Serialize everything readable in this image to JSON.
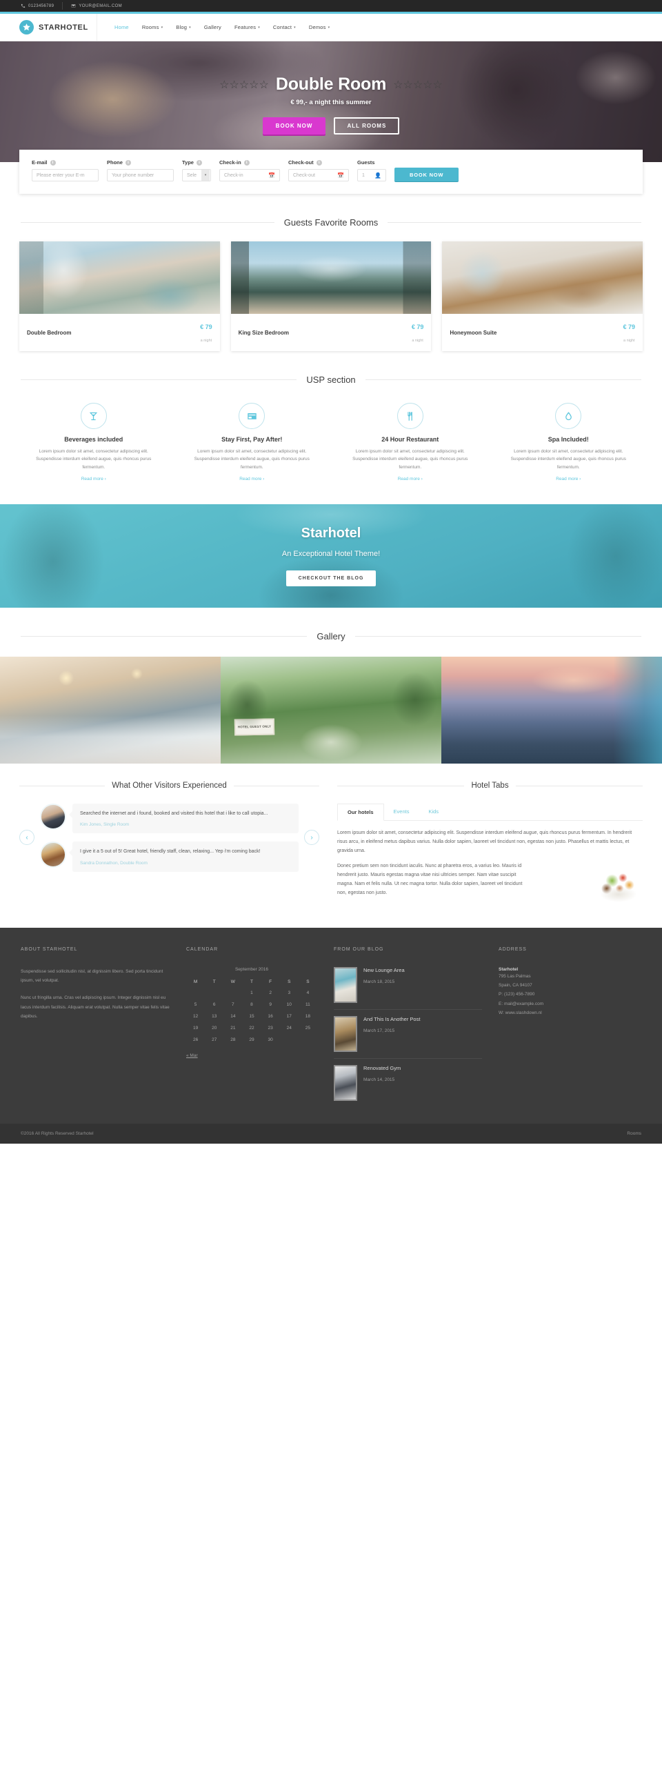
{
  "topbar": {
    "phone": "0123456789",
    "email": "YOUR@EMAIL.COM",
    "phone_icon": "phone-icon",
    "email_icon": "envelope-icon"
  },
  "brand": {
    "name": "STARHOTEL",
    "logo_icon": "star-logo-icon"
  },
  "nav": [
    {
      "label": "Home",
      "active": true,
      "caret": ""
    },
    {
      "label": "Rooms",
      "active": false,
      "caret": "⌄"
    },
    {
      "label": "Blog",
      "active": false,
      "caret": "⌄"
    },
    {
      "label": "Gallery",
      "active": false,
      "caret": ""
    },
    {
      "label": "Features",
      "active": false,
      "caret": "⌄"
    },
    {
      "label": "Contact",
      "active": false,
      "caret": "⌄"
    },
    {
      "label": "Demos",
      "active": false,
      "caret": "⌄"
    }
  ],
  "hero": {
    "stars_left": "☆☆☆☆☆",
    "title": "Double Room",
    "stars_right": "☆☆☆☆☆",
    "subtitle": "€ 99,- a night this summer",
    "book_label": "BOOK NOW",
    "rooms_label": "ALL ROOMS",
    "accent_pink": "#d938cf"
  },
  "booking": {
    "email": {
      "label": "E-mail",
      "placeholder": "Please enter your E-m"
    },
    "phone": {
      "label": "Phone",
      "placeholder": "Your phone number"
    },
    "type": {
      "label": "Type",
      "value": "Sele"
    },
    "checkin": {
      "label": "Check-in",
      "placeholder": "Check-in"
    },
    "checkout": {
      "label": "Check-out",
      "placeholder": "Check-out"
    },
    "guests": {
      "label": "Guests",
      "value": "1"
    },
    "submit_label": "BOOK NOW",
    "accent": "#4cb8cf"
  },
  "rooms_section": {
    "title": "Guests Favorite Rooms",
    "per_night": "a night",
    "items": [
      {
        "name": "Double Bedroom",
        "price": "€ 79"
      },
      {
        "name": "King Size Bedroom",
        "price": "€ 79"
      },
      {
        "name": "Honeymoon Suite",
        "price": "€ 79"
      }
    ]
  },
  "usp_section": {
    "title": "USP section",
    "body": "Lorem ipsum dolor sit amet, consectetur adipiscing elit. Suspendisse interdum eleifend augue, quis rhoncus purus fermentum.",
    "read_more": "Read more ›",
    "items": [
      {
        "title": "Beverages included",
        "icon": "cocktail-glass-icon"
      },
      {
        "title": "Stay First, Pay After!",
        "icon": "credit-card-icon"
      },
      {
        "title": "24 Hour Restaurant",
        "icon": "cutlery-icon"
      },
      {
        "title": "Spa Included!",
        "icon": "spa-drop-icon"
      }
    ]
  },
  "cta": {
    "title": "Starhotel",
    "subtitle": "An Exceptional Hotel Theme!",
    "button_label": "CHECKOUT THE BLOG"
  },
  "gallery": {
    "title": "Gallery",
    "sign_text": "HOTEL GUEST ONLY",
    "items": [
      {
        "alt": "restaurant-kitchen-photo"
      },
      {
        "alt": "garden-path-photo"
      },
      {
        "alt": "poolside-sunset-photo"
      }
    ]
  },
  "testimonials": {
    "title": "What Other Visitors Experienced",
    "prev_icon": "chevron-left-icon",
    "next_icon": "chevron-right-icon",
    "items": [
      {
        "quote": "Searched the internet and i found, booked and visited this hotel that i like to call utopia...",
        "who": "Kim Jones, Single Room",
        "avatar": "male-avatar"
      },
      {
        "quote": "I give it a 5 out of 5! Great hotel, friendly staff, clean, relaxing... Yep i'm coming back!",
        "who": "Sandra Donnathon, Double Room",
        "avatar": "female-avatar"
      }
    ]
  },
  "hotel_tabs": {
    "title": "Hotel Tabs",
    "tabs": [
      {
        "label": "Our hotels",
        "active": true
      },
      {
        "label": "Events",
        "active": false
      },
      {
        "label": "Kids",
        "active": false
      }
    ],
    "paragraph_1": "Lorem ipsum dolor sit amet, consectetur adipiscing elit. Suspendisse interdum eleifend augue, quis rhoncus purus fermentum. In hendrerit risus arcu, in eleifend metus dapibus varius. Nulla dolor sapien, laoreet vel tincidunt non, egestas non justo. Phasellus et mattis lectus, et gravida urna.",
    "paragraph_2": "Donec pretium sem non tincidunt iaculis. Nunc at pharetra eros, a varius leo. Mauris id hendrerit justo. Mauris egestas magna vitae nisi ultricies semper. Nam vitae suscipit magna. Nam et felis nulla. Ut nec magna tortor. Nulla dolor sapien, laoreet vel tincidunt non, egestas non justo."
  },
  "footer": {
    "about": {
      "heading": "ABOUT STARHOTEL",
      "p1": "Suspendisse sed sollicitudin nisl, at dignissim libero. Sed porta tincidunt ipsum, vel volutpat.",
      "p2": "Nunc ut fringilla urna. Cras vel adipiscing ipsum. Integer dignissim nisl eu lacus interdum facilisis. Aliquam erat volutpat. Nulla semper vitae felis vitae dapibus."
    },
    "calendar": {
      "heading": "CALENDAR",
      "month": "September 2016",
      "daynames": [
        "M",
        "T",
        "W",
        "T",
        "F",
        "S",
        "S"
      ],
      "weeks": [
        [
          "",
          "",
          "",
          "1",
          "2",
          "3",
          "4"
        ],
        [
          "5",
          "6",
          "7",
          "8",
          "9",
          "10",
          "11"
        ],
        [
          "12",
          "13",
          "14",
          "15",
          "16",
          "17",
          "18"
        ],
        [
          "19",
          "20",
          "21",
          "22",
          "23",
          "24",
          "25"
        ],
        [
          "26",
          "27",
          "28",
          "29",
          "30",
          "",
          ""
        ]
      ],
      "prev_link": "« Mar"
    },
    "blog": {
      "heading": "FROM OUR BLOG",
      "posts": [
        {
          "title": "New Lounge Area",
          "date": "March 18, 2015",
          "thumb": "lounge-thumb"
        },
        {
          "title": "And This Is Another Post",
          "date": "March 17, 2015",
          "thumb": "interior-thumb"
        },
        {
          "title": "Renovated Gym",
          "date": "March 14, 2015",
          "thumb": "gym-thumb"
        }
      ]
    },
    "address": {
      "heading": "ADDRESS",
      "name": "Starhotel",
      "street": "795 Las Palmas",
      "city": "Spain, CA 94107",
      "phone": "P: (123) 456-7890",
      "email": "E: mail@example.com",
      "web": "W: www.slashdown.nl"
    }
  },
  "bottom": {
    "copyright": "©2016 All Rights Reserved Starhotel",
    "link": "Rooms"
  }
}
